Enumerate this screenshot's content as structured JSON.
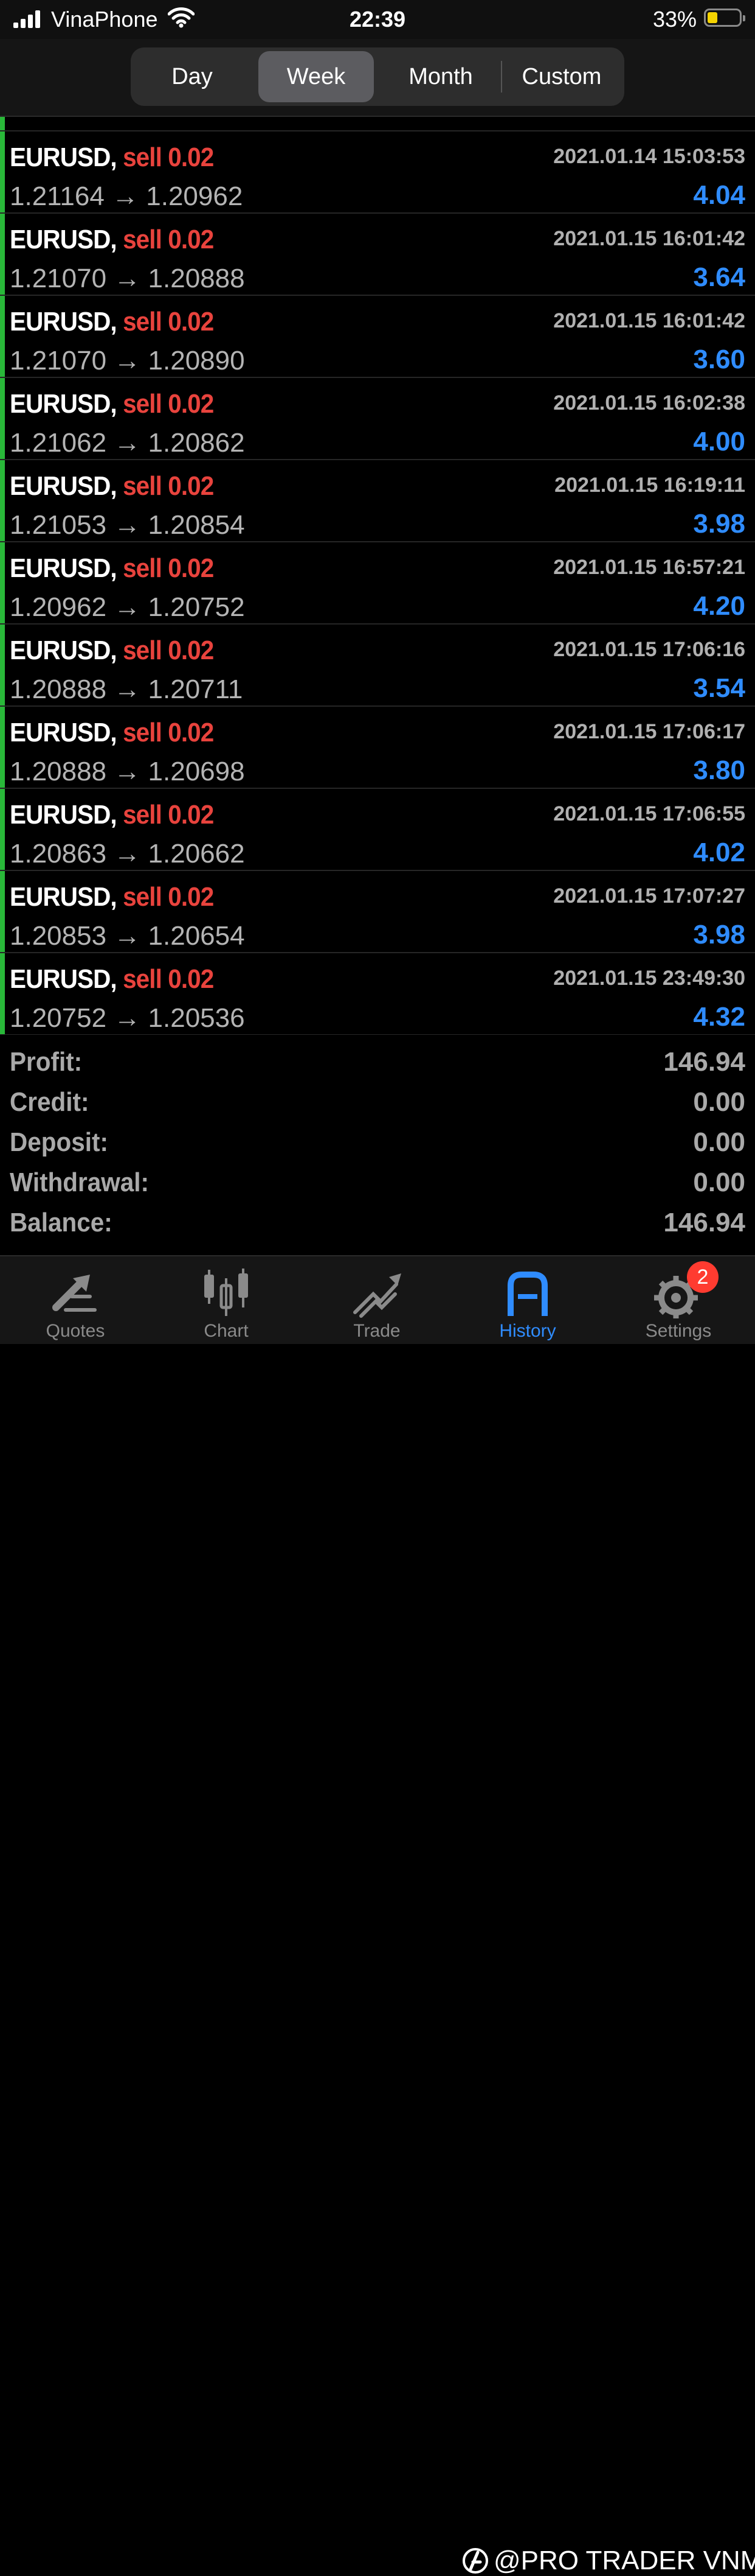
{
  "status_bar": {
    "carrier": "VinaPhone",
    "time": "22:39",
    "battery_percent": "33%",
    "battery_level": 0.33
  },
  "period_tabs": [
    {
      "label": "Day",
      "active": false
    },
    {
      "label": "Week",
      "active": true
    },
    {
      "label": "Month",
      "active": false
    },
    {
      "label": "Custom",
      "active": false
    }
  ],
  "deals": [
    {
      "symbol": "EURUSD,",
      "side": "sell 0.02",
      "time": "2021.01.14 15:03:53",
      "open": "1.21164",
      "close": "1.20962",
      "profit": "4.04"
    },
    {
      "symbol": "EURUSD,",
      "side": "sell 0.02",
      "time": "2021.01.15 16:01:42",
      "open": "1.21070",
      "close": "1.20888",
      "profit": "3.64"
    },
    {
      "symbol": "EURUSD,",
      "side": "sell 0.02",
      "time": "2021.01.15 16:01:42",
      "open": "1.21070",
      "close": "1.20890",
      "profit": "3.60"
    },
    {
      "symbol": "EURUSD,",
      "side": "sell 0.02",
      "time": "2021.01.15 16:02:38",
      "open": "1.21062",
      "close": "1.20862",
      "profit": "4.00"
    },
    {
      "symbol": "EURUSD,",
      "side": "sell 0.02",
      "time": "2021.01.15 16:19:11",
      "open": "1.21053",
      "close": "1.20854",
      "profit": "3.98"
    },
    {
      "symbol": "EURUSD,",
      "side": "sell 0.02",
      "time": "2021.01.15 16:57:21",
      "open": "1.20962",
      "close": "1.20752",
      "profit": "4.20"
    },
    {
      "symbol": "EURUSD,",
      "side": "sell 0.02",
      "time": "2021.01.15 17:06:16",
      "open": "1.20888",
      "close": "1.20711",
      "profit": "3.54"
    },
    {
      "symbol": "EURUSD,",
      "side": "sell 0.02",
      "time": "2021.01.15 17:06:17",
      "open": "1.20888",
      "close": "1.20698",
      "profit": "3.80"
    },
    {
      "symbol": "EURUSD,",
      "side": "sell 0.02",
      "time": "2021.01.15 17:06:55",
      "open": "1.20863",
      "close": "1.20662",
      "profit": "4.02"
    },
    {
      "symbol": "EURUSD,",
      "side": "sell 0.02",
      "time": "2021.01.15 17:07:27",
      "open": "1.20853",
      "close": "1.20654",
      "profit": "3.98"
    },
    {
      "symbol": "EURUSD,",
      "side": "sell 0.02",
      "time": "2021.01.15 23:49:30",
      "open": "1.20752",
      "close": "1.20536",
      "profit": "4.32"
    }
  ],
  "arrow": "→",
  "summary": [
    {
      "label": "Profit:",
      "value": "146.94"
    },
    {
      "label": "Credit:",
      "value": "0.00"
    },
    {
      "label": "Deposit:",
      "value": "0.00"
    },
    {
      "label": "Withdrawal:",
      "value": "0.00"
    },
    {
      "label": "Balance:",
      "value": "146.94"
    }
  ],
  "tabs": [
    {
      "label": "Quotes",
      "icon": "quotes-icon",
      "active": false
    },
    {
      "label": "Chart",
      "icon": "chart-icon",
      "active": false
    },
    {
      "label": "Trade",
      "icon": "trade-icon",
      "active": false
    },
    {
      "label": "History",
      "icon": "history-icon",
      "active": true
    },
    {
      "label": "Settings",
      "icon": "settings-icon",
      "active": false
    }
  ],
  "settings_badge": "2",
  "watermark": "@PRO TRADER VNM",
  "colors": {
    "profit_blue": "#2f8cff",
    "sell_red": "#e8433d",
    "edge_green": "#29b839",
    "badge_red": "#ff3b30"
  }
}
